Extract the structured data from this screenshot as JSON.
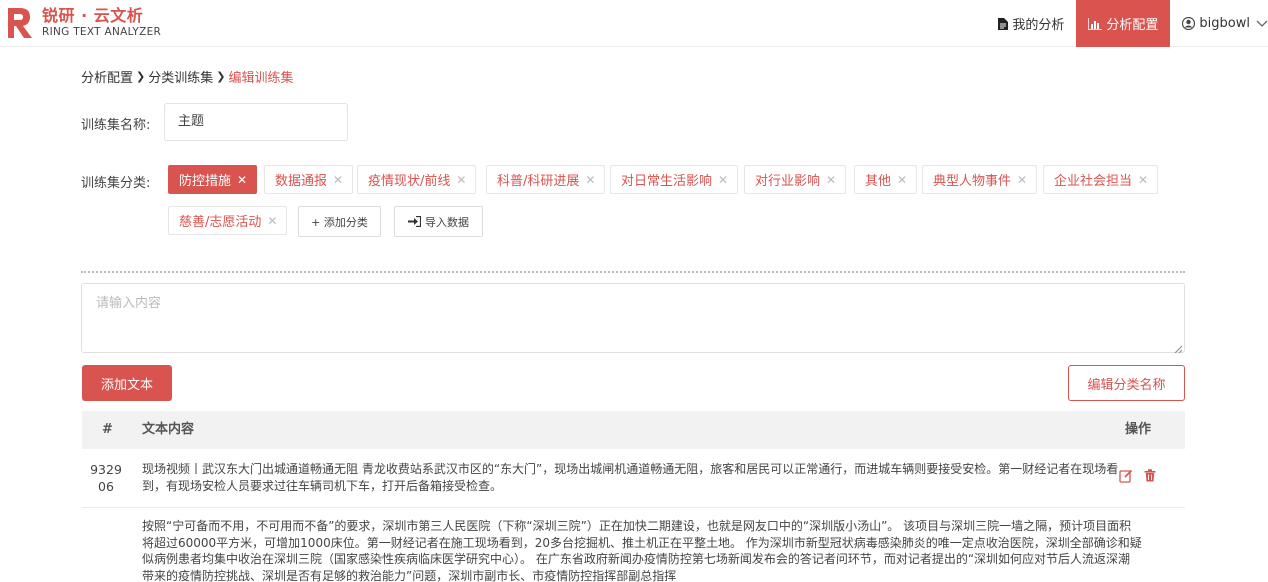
{
  "brand": {
    "title": "锐研 · 云文析",
    "subtitle": "RING TEXT ANALYZER"
  },
  "nav": {
    "my_analysis": "我的分析",
    "analysis_config": "分析配置",
    "user": "bigbowl"
  },
  "breadcrumb": [
    "分析配置",
    "分类训练集",
    "编辑训练集"
  ],
  "form": {
    "name_label": "训练集名称:",
    "name_value": "主题",
    "category_label": "训练集分类:"
  },
  "tags": [
    {
      "label": "防控措施",
      "active": true
    },
    {
      "label": "数据通报",
      "active": false
    },
    {
      "label": "疫情现状/前线",
      "active": false
    },
    {
      "label": "科普/科研进展",
      "active": false
    },
    {
      "label": "对日常生活影响",
      "active": false
    },
    {
      "label": "对行业影响",
      "active": false
    },
    {
      "label": "其他",
      "active": false
    },
    {
      "label": "典型人物事件",
      "active": false
    },
    {
      "label": "企业社会担当",
      "active": false
    },
    {
      "label": "慈善/志愿活动",
      "active": false
    }
  ],
  "buttons": {
    "add_category": "+ 添加分类",
    "import_data": "导入数据",
    "add_text": "添加文本",
    "edit_category_name": "编辑分类名称"
  },
  "textarea": {
    "placeholder": "请输入内容"
  },
  "table": {
    "headers": [
      "#",
      "文本内容",
      "操作"
    ],
    "rows": [
      {
        "id": "932906",
        "text": "现场视频丨武汉东大门出城通道畅通无阻 青龙收费站系武汉市区的“东大门”，现场出城闸机通道畅通无阻，旅客和居民可以正常通行，而进城车辆则要接受安检。第一财经记者在现场看到，有现场安检人员要求过往车辆司机下车，打开后备箱接受检查。"
      },
      {
        "id": "",
        "text": "按照“宁可备而不用，不可用而不备”的要求，深圳市第三人民医院（下称“深圳三院”）正在加快二期建设，也就是网友口中的“深圳版小汤山”。 该项目与深圳三院一墙之隔，预计项目面积将超过60000平方米，可增加1000床位。第一财经记者在施工现场看到，20多台挖掘机、推土机正在平整土地。 作为深圳市新型冠状病毒感染肺炎的唯一定点收治医院，深圳全部确诊和疑似病例患者均集中收治在深圳三院（国家感染性疾病临床医学研究中心）。 在广东省政府新闻办疫情防控第七场新闻发布会的答记者问环节，而对记者提出的“深圳如何应对节后人流返深潮带来的疫情防控挑战、深圳是否有足够的救治能力”问题，深圳市副市长、市疫情防控指挥部副总指挥"
      }
    ]
  },
  "colors": {
    "accent": "#d9534f"
  }
}
